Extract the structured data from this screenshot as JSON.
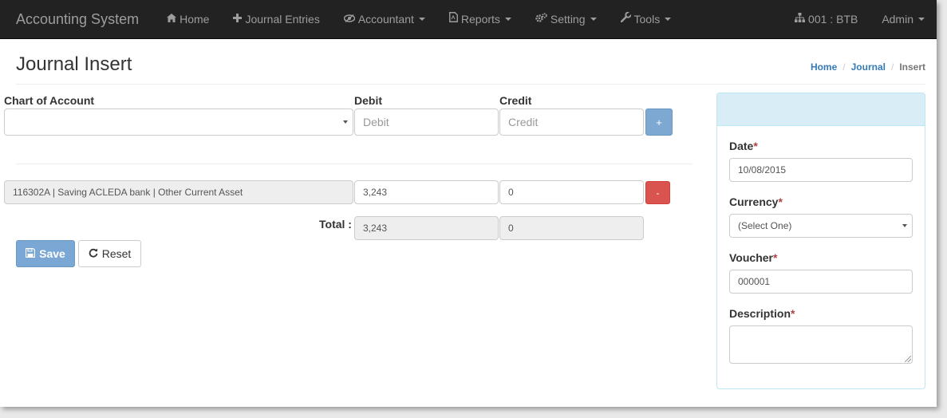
{
  "navbar": {
    "brand": "Accounting System",
    "items": [
      {
        "label": "Home",
        "icon": "home-icon"
      },
      {
        "label": "Journal Entries",
        "icon": "plus-icon"
      },
      {
        "label": "Accountant",
        "icon": "eye-slash-icon",
        "dropdown": true
      },
      {
        "label": "Reports",
        "icon": "pdf-file-icon",
        "dropdown": true
      },
      {
        "label": "Setting",
        "icon": "cogs-icon",
        "dropdown": true
      },
      {
        "label": "Tools",
        "icon": "wrench-icon",
        "dropdown": true
      }
    ],
    "branch": "001 : BTB",
    "user": "Admin"
  },
  "header": {
    "title": "Journal Insert",
    "breadcrumb": [
      "Home",
      "Journal",
      "Insert"
    ]
  },
  "form": {
    "account_label": "Chart of Account",
    "debit_label": "Debit",
    "credit_label": "Credit",
    "debit_placeholder": "Debit",
    "credit_placeholder": "Credit",
    "add_label": "+",
    "remove_label": "-",
    "entries": [
      {
        "account": "116302A | Saving ACLEDA bank | Other Current Asset",
        "debit": "3,243",
        "credit": "0"
      }
    ],
    "total_label": "Total :",
    "total_debit": "3,243",
    "total_credit": "0",
    "save_label": "Save",
    "reset_label": "Reset"
  },
  "panel": {
    "date_label": "Date",
    "date_value": "10/08/2015",
    "currency_label": "Currency",
    "currency_value": "(Select One)",
    "voucher_label": "Voucher",
    "voucher_value": "000001",
    "description_label": "Description",
    "description_value": "",
    "required_mark": "*"
  },
  "colors": {
    "navbar_bg": "#222222",
    "primary": "#337ab7",
    "danger": "#d9534f",
    "panel_head": "#d9edf7"
  }
}
